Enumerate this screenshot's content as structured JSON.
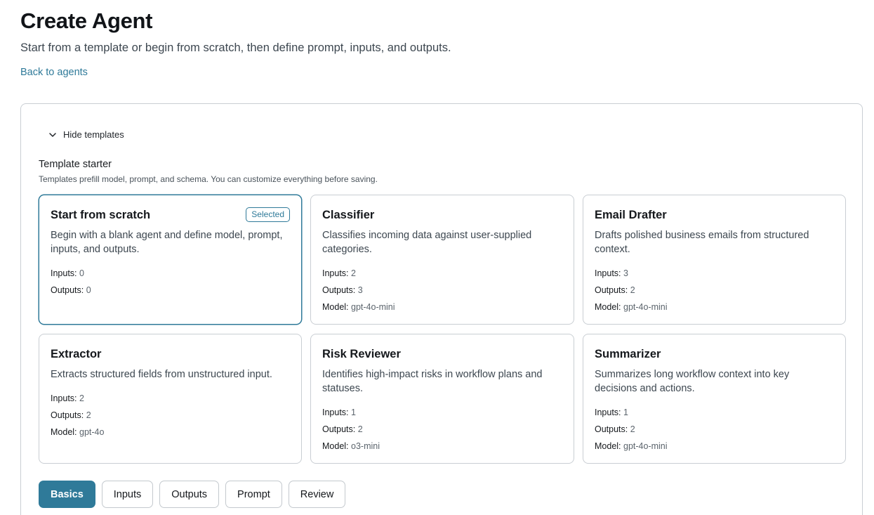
{
  "header": {
    "title": "Create Agent",
    "subtitle": "Start from a template or begin from scratch, then define prompt, inputs, and outputs.",
    "back_link": "Back to agents"
  },
  "templates": {
    "toggle_label": "Hide templates",
    "toggle_icon": "chevron-down-icon",
    "starter_title": "Template starter",
    "starter_desc": "Templates prefill model, prompt, and schema. You can customize everything before saving.",
    "labels": {
      "inputs": "Inputs:",
      "outputs": "Outputs:",
      "model": "Model:"
    },
    "selected_badge": "Selected",
    "cards": [
      {
        "name": "Start from scratch",
        "desc": "Begin with a blank agent and define model, prompt, inputs, and outputs.",
        "inputs": "0",
        "outputs": "0",
        "model": null,
        "selected": true
      },
      {
        "name": "Classifier",
        "desc": "Classifies incoming data against user-supplied categories.",
        "inputs": "2",
        "outputs": "3",
        "model": "gpt-4o-mini",
        "selected": false
      },
      {
        "name": "Email Drafter",
        "desc": "Drafts polished business emails from structured context.",
        "inputs": "3",
        "outputs": "2",
        "model": "gpt-4o-mini",
        "selected": false
      },
      {
        "name": "Extractor",
        "desc": "Extracts structured fields from unstructured input.",
        "inputs": "2",
        "outputs": "2",
        "model": "gpt-4o",
        "selected": false
      },
      {
        "name": "Risk Reviewer",
        "desc": "Identifies high-impact risks in workflow plans and statuses.",
        "inputs": "1",
        "outputs": "2",
        "model": "o3-mini",
        "selected": false
      },
      {
        "name": "Summarizer",
        "desc": "Summarizes long workflow context into key decisions and actions.",
        "inputs": "1",
        "outputs": "2",
        "model": "gpt-4o-mini",
        "selected": false
      }
    ]
  },
  "tabs": [
    {
      "label": "Basics",
      "active": true
    },
    {
      "label": "Inputs",
      "active": false
    },
    {
      "label": "Outputs",
      "active": false
    },
    {
      "label": "Prompt",
      "active": false
    },
    {
      "label": "Review",
      "active": false
    }
  ],
  "colors": {
    "accent": "#2f7a99",
    "border": "#c9ced3",
    "text": "#15181c",
    "muted": "#3d4750"
  }
}
